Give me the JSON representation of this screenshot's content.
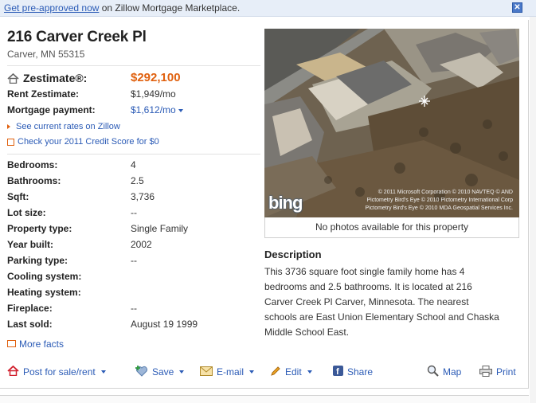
{
  "banner": {
    "link_text": "Get pre-approved now",
    "rest_text": " on Zillow Mortgage Marketplace.",
    "close_glyph": "✕"
  },
  "property": {
    "address": "216 Carver Creek Pl",
    "city_state_zip": "Carver, MN 55315"
  },
  "zestimate": {
    "label": "Zestimate®:",
    "value": "$292,100"
  },
  "rent_zestimate": {
    "label": "Rent Zestimate:",
    "value": "$1,949/mo"
  },
  "mortgage": {
    "label": "Mortgage payment:",
    "value": "$1,612/mo"
  },
  "links": {
    "rates": "See current rates on Zillow",
    "credit": "Check your 2011 Credit Score for $0"
  },
  "facts": [
    {
      "label": "Bedrooms:",
      "value": "4"
    },
    {
      "label": "Bathrooms:",
      "value": "2.5"
    },
    {
      "label": "Sqft:",
      "value": "3,736"
    },
    {
      "label": "Lot size:",
      "value": "--"
    },
    {
      "label": "Property type:",
      "value": "Single Family"
    },
    {
      "label": "Year built:",
      "value": "2002"
    },
    {
      "label": "Parking type:",
      "value": "--"
    },
    {
      "label": "Cooling system:",
      "value": ""
    },
    {
      "label": "Heating system:",
      "value": ""
    },
    {
      "label": "Fireplace:",
      "value": "--"
    },
    {
      "label": "Last sold:",
      "value": "August 19 1999"
    }
  ],
  "more_facts": "More facts",
  "photo": {
    "caption": "No photos available for this property",
    "copyright_1": "© 2011 Microsoft Corporation  © 2010 NAVTEQ  © AND",
    "copyright_2": "Pictometry Bird's Eye © 2010 Pictometry International Corp",
    "copyright_3": "Pictometry Bird's Eye © 2010 MDA Geospatial Services Inc.",
    "bing_logo": "bing"
  },
  "description": {
    "heading": "Description",
    "body": "This 3736 square foot single family home has 4 bedrooms and 2.5 bathrooms. It is located at 216 Carver Creek Pl Carver, Minnesota. The nearest schools are East Union Elementary School and Chaska Middle School East."
  },
  "toolbar": {
    "post": "Post for sale/rent",
    "save": "Save",
    "email": "E-mail",
    "edit": "Edit",
    "share": "Share",
    "map": "Map",
    "print": "Print"
  },
  "colors": {
    "accent_orange": "#e0610f",
    "link_blue": "#2b5bb6",
    "banner_bg": "#e7eef8"
  }
}
